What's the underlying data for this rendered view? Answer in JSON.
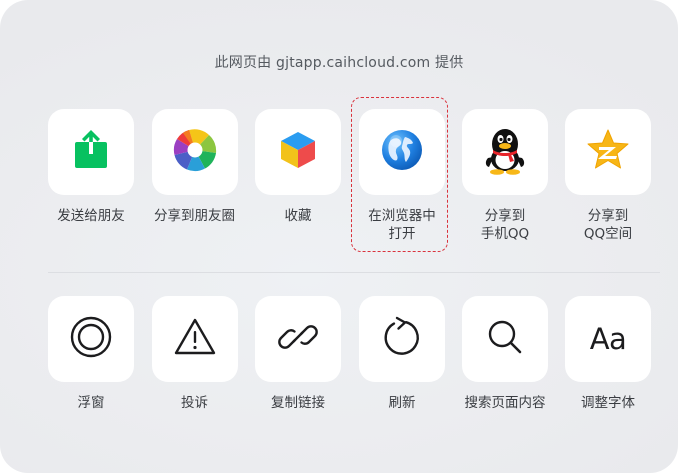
{
  "share_sheet": {
    "source_text": "此网页由 gjtapp.caihcloud.com 提供",
    "row1": [
      {
        "id": "send-to-friend",
        "label_lines": [
          "发送给朋友"
        ],
        "icon": "share-upload-icon"
      },
      {
        "id": "share-to-moments",
        "label_lines": [
          "分享到朋友圈"
        ],
        "icon": "moments-aperture-icon"
      },
      {
        "id": "favorite",
        "label_lines": [
          "收藏"
        ],
        "icon": "favorite-cube-icon"
      },
      {
        "id": "open-in-browser",
        "label_lines": [
          "在浏览器中",
          "打开"
        ],
        "icon": "globe-icon"
      },
      {
        "id": "share-to-qq",
        "label_lines": [
          "分享到",
          "手机QQ"
        ],
        "icon": "qq-penguin-icon"
      },
      {
        "id": "share-to-qzone",
        "label_lines": [
          "分享到",
          "QQ空间"
        ],
        "icon": "qzone-star-icon"
      }
    ],
    "row2": [
      {
        "id": "floating-window",
        "label_lines": [
          "浮窗"
        ],
        "icon": "floating-window-icon"
      },
      {
        "id": "complain",
        "label_lines": [
          "投诉"
        ],
        "icon": "warning-icon"
      },
      {
        "id": "copy-link",
        "label_lines": [
          "复制链接"
        ],
        "icon": "link-icon"
      },
      {
        "id": "refresh",
        "label_lines": [
          "刷新"
        ],
        "icon": "refresh-icon"
      },
      {
        "id": "search-page",
        "label_lines": [
          "搜索页面内容"
        ],
        "icon": "search-icon"
      },
      {
        "id": "adjust-font",
        "label_lines": [
          "调整字体"
        ],
        "icon": "font-size-icon",
        "glyph": "Aa"
      }
    ]
  },
  "colors": {
    "wechat_green": "#07c160",
    "highlight_red": "#d9323c",
    "tile_bg": "#ffffff",
    "label_text": "#3a3d42"
  }
}
